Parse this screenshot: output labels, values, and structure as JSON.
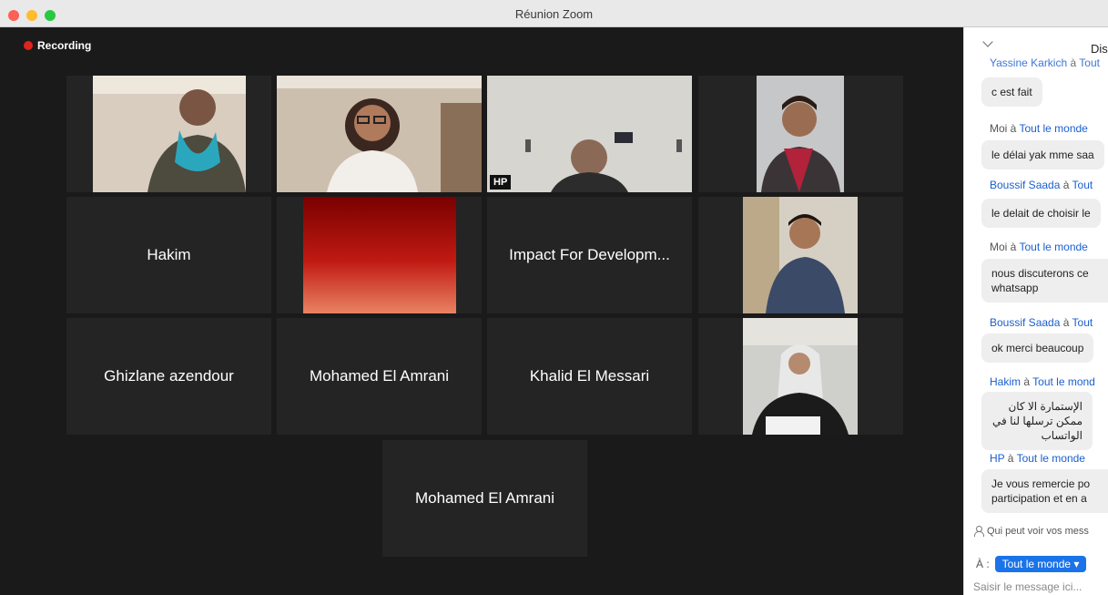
{
  "window": {
    "title": "Réunion Zoom"
  },
  "recording": {
    "label": "Recording"
  },
  "tiles": {
    "hakim": "Hakim",
    "impact": "Impact For Developm...",
    "ghizlane": "Ghizlane azendour",
    "mohamed1": "Mohamed El Amrani",
    "khalid": "Khalid El Messari",
    "mohamed2": "Mohamed El Amrani",
    "hp_tag": "HP"
  },
  "chat": {
    "header_title": "Dis",
    "messages": [
      {
        "sender": "Yassine Karkich",
        "sep": " à ",
        "to": "Tout",
        "text": "c est fait"
      },
      {
        "sender": "Moi",
        "sep": " à ",
        "to": "Tout le monde",
        "text": "le délai yak mme saa"
      },
      {
        "sender": "Boussif Saada",
        "sep": " à ",
        "to": "Tout",
        "text": "le delait de choisir le"
      },
      {
        "sender": "Moi",
        "sep": " à ",
        "to": "Tout le monde",
        "text": "nous discuterons ce whatsapp"
      },
      {
        "sender": "Boussif Saada",
        "sep": " à ",
        "to": "Tout",
        "text": "ok merci beaucoup"
      },
      {
        "sender": "Hakim",
        "sep": " à ",
        "to": "Tout le mond",
        "text": "الإستمارة الا كان ممكن ترسلها لنا في الواتساب"
      },
      {
        "sender": "HP",
        "sep": " à ",
        "to": "Tout le monde",
        "text": "Je vous remercie po participation et en a"
      }
    ],
    "visibility_text": "Qui peut voir vos mess",
    "to_label": "À :",
    "to_value": "Tout le monde ▾",
    "input_placeholder": "Saisir le message ici..."
  },
  "colors": {
    "active_speaker": "#b5e27b",
    "recording_dot": "#e0231c",
    "chat_link": "#1a5fd0",
    "to_button": "#1a73e8"
  }
}
